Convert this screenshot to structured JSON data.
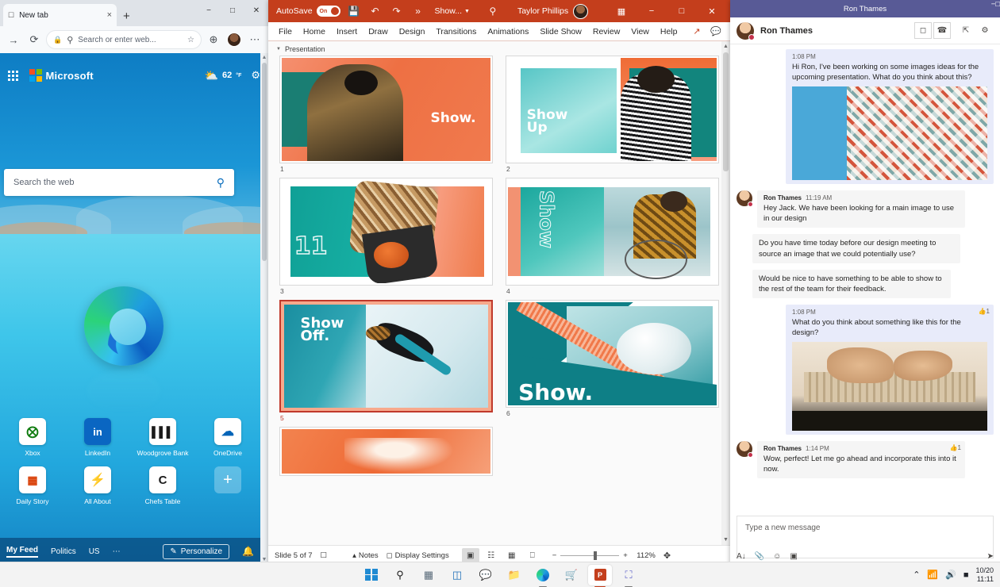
{
  "edge": {
    "tab": {
      "title": "New tab",
      "close_label": "×",
      "new_tab_label": "+"
    },
    "window_controls": {
      "minimize": "−",
      "maximize": "□",
      "close": "✕"
    },
    "toolbar": {
      "back": "←",
      "forward": "→",
      "refresh": "⟳",
      "home": "⌂",
      "search_icon": "search-icon",
      "address_placeholder": "Search or enter web...",
      "favorite": "☆",
      "collections": "⊕",
      "profile": "avatar",
      "more": "⋯"
    },
    "newtab": {
      "brand": "Microsoft",
      "weather_temp": "62",
      "weather_unit": "°F",
      "settings_icon": "gear-icon",
      "search_placeholder": "Search the web",
      "tiles": [
        {
          "label": "Xbox",
          "glyph": "⊗",
          "color": "#107c10"
        },
        {
          "label": "LinkedIn",
          "glyph": "in",
          "color": "#0a66c2"
        },
        {
          "label": "Woodgrove Bank",
          "glyph": "‖‖",
          "color": "#1b1b1b"
        },
        {
          "label": "OneDrive",
          "glyph": "☁",
          "color": "#0364b8"
        },
        {
          "label": "Daily Story",
          "glyph": "▦",
          "color": "#d83b01"
        },
        {
          "label": "All About",
          "glyph": "⚡",
          "color": "#f7630c"
        },
        {
          "label": "Chefs Table",
          "glyph": "C",
          "color": "#1b1b1b"
        },
        {
          "label": "",
          "glyph": "+",
          "color": "#ffffff"
        }
      ],
      "feed": {
        "items": [
          "My Feed",
          "Politics",
          "US",
          "⋯"
        ],
        "active": "My Feed",
        "personalize": "Personalize",
        "bell_icon": "bell-icon"
      }
    }
  },
  "powerpoint": {
    "titlebar": {
      "autosave_label": "AutoSave",
      "autosave_state": "On",
      "save_icon": "save-icon",
      "undo_icon": "undo-icon",
      "redo_icon": "redo-icon",
      "more_icon": "»",
      "document_name": "Show...",
      "search_icon": "search-icon",
      "user_name": "Taylor Phillips",
      "present_icon": "present-icon",
      "minimize": "−",
      "maximize": "□",
      "close": "✕"
    },
    "ribbon": {
      "tabs": [
        "File",
        "Home",
        "Insert",
        "Draw",
        "Design",
        "Transitions",
        "Animations",
        "Slide Show",
        "Review",
        "View",
        "Help"
      ],
      "active_tab": "Home",
      "share_icon": "share-icon",
      "comments_icon": "comments-icon"
    },
    "section_name": "Presentation",
    "slides": [
      {
        "number": "1",
        "caption": "Show.",
        "selected": false
      },
      {
        "number": "2",
        "caption": "Show Up",
        "selected": false
      },
      {
        "number": "3",
        "caption": "11",
        "selected": false
      },
      {
        "number": "4",
        "caption": "Show",
        "selected": false
      },
      {
        "number": "5",
        "caption": "Show Off.",
        "selected": true
      },
      {
        "number": "6",
        "caption": "Show.",
        "selected": false
      },
      {
        "number": "7",
        "caption": "",
        "selected": false
      }
    ],
    "status": {
      "slide_counter": "Slide 5 of 7",
      "language_icon": "language-icon",
      "notes_label": "Notes",
      "display_settings_label": "Display Settings",
      "view_normal": "normal-view-icon",
      "view_sorter": "slide-sorter-icon",
      "view_reading": "reading-view-icon",
      "view_slideshow": "slideshow-icon",
      "zoom_out": "−",
      "zoom_in": "+",
      "zoom_level": "112%",
      "fit_icon": "fit-to-window-icon"
    }
  },
  "teams": {
    "window_title": "Ron Thames",
    "window_controls": {
      "minimize": "−",
      "maximize": "□"
    },
    "header": {
      "contact_name": "Ron Thames",
      "video_call_icon": "video-call-icon",
      "audio_call_icon": "phone-icon",
      "share_screen_icon": "share-screen-icon",
      "add_people_icon": "add-people-icon"
    },
    "messages": [
      {
        "side": "me",
        "sender": "",
        "time": "1:08 PM",
        "text": "Hi Ron, I've been working on some images ideas for the upcoming presentation. What do you think about this?",
        "has_image": true,
        "image_kind": "triangles-pattern",
        "reaction": ""
      },
      {
        "side": "them",
        "sender": "Ron Thames",
        "time": "11:19 AM",
        "text": "Hey Jack. We have been looking for a main image to use in our design",
        "has_image": false,
        "reaction": ""
      },
      {
        "side": "them",
        "sender": "",
        "time": "",
        "text": "Do you have time today before our design meeting to source an image that we could potentially use?",
        "has_image": false,
        "reaction": ""
      },
      {
        "side": "them",
        "sender": "",
        "time": "",
        "text": "Would be nice to have something to be able to show to the rest of the team for their feedback.",
        "has_image": false,
        "reaction": ""
      },
      {
        "side": "me",
        "sender": "",
        "time": "1:08 PM",
        "text": "What do you think about something like this for the design?",
        "has_image": true,
        "image_kind": "hands-model",
        "reaction": "👍1"
      },
      {
        "side": "them",
        "sender": "Ron Thames",
        "time": "1:14 PM",
        "text": "Wow, perfect! Let me go ahead and incorporate this into it now.",
        "has_image": false,
        "reaction": "👍1"
      }
    ],
    "compose": {
      "placeholder": "Type a new message",
      "format_icon": "format-icon",
      "attach_icon": "attach-icon",
      "emoji_icon": "emoji-icon",
      "giphy_icon": "giphy-icon",
      "send_icon": "send-icon"
    }
  },
  "taskbar": {
    "items": [
      {
        "name": "start-button",
        "glyph": "⊞",
        "active": false
      },
      {
        "name": "search-button",
        "glyph": "⚲",
        "active": false
      },
      {
        "name": "widgets-button",
        "glyph": "◨",
        "active": false
      },
      {
        "name": "task-view-button",
        "glyph": "◫",
        "active": false
      },
      {
        "name": "teams-chat-button",
        "glyph": "◔",
        "active": false
      },
      {
        "name": "file-explorer-button",
        "glyph": "▰",
        "active": false
      },
      {
        "name": "edge-button",
        "glyph": "e",
        "active": false,
        "running": true
      },
      {
        "name": "store-button",
        "glyph": "▣",
        "active": false
      },
      {
        "name": "powerpoint-button",
        "glyph": "P",
        "active": true,
        "running": true
      },
      {
        "name": "teams-button",
        "glyph": "Ⓣ",
        "active": false,
        "running": true
      }
    ],
    "tray": {
      "chevron": "⌃",
      "wifi_icon": "wifi-icon",
      "volume_icon": "volume-icon",
      "battery_icon": "battery-icon",
      "date": "10/20",
      "time": "11:11"
    }
  },
  "colors": {
    "powerpoint_accent": "#c43e1c",
    "teams_accent": "#585a96",
    "edge_blue": "#0a6ebd",
    "selection_red": "#c0392b",
    "slide_teal": "#0f7b87",
    "slide_orange": "#ee6c3d"
  }
}
